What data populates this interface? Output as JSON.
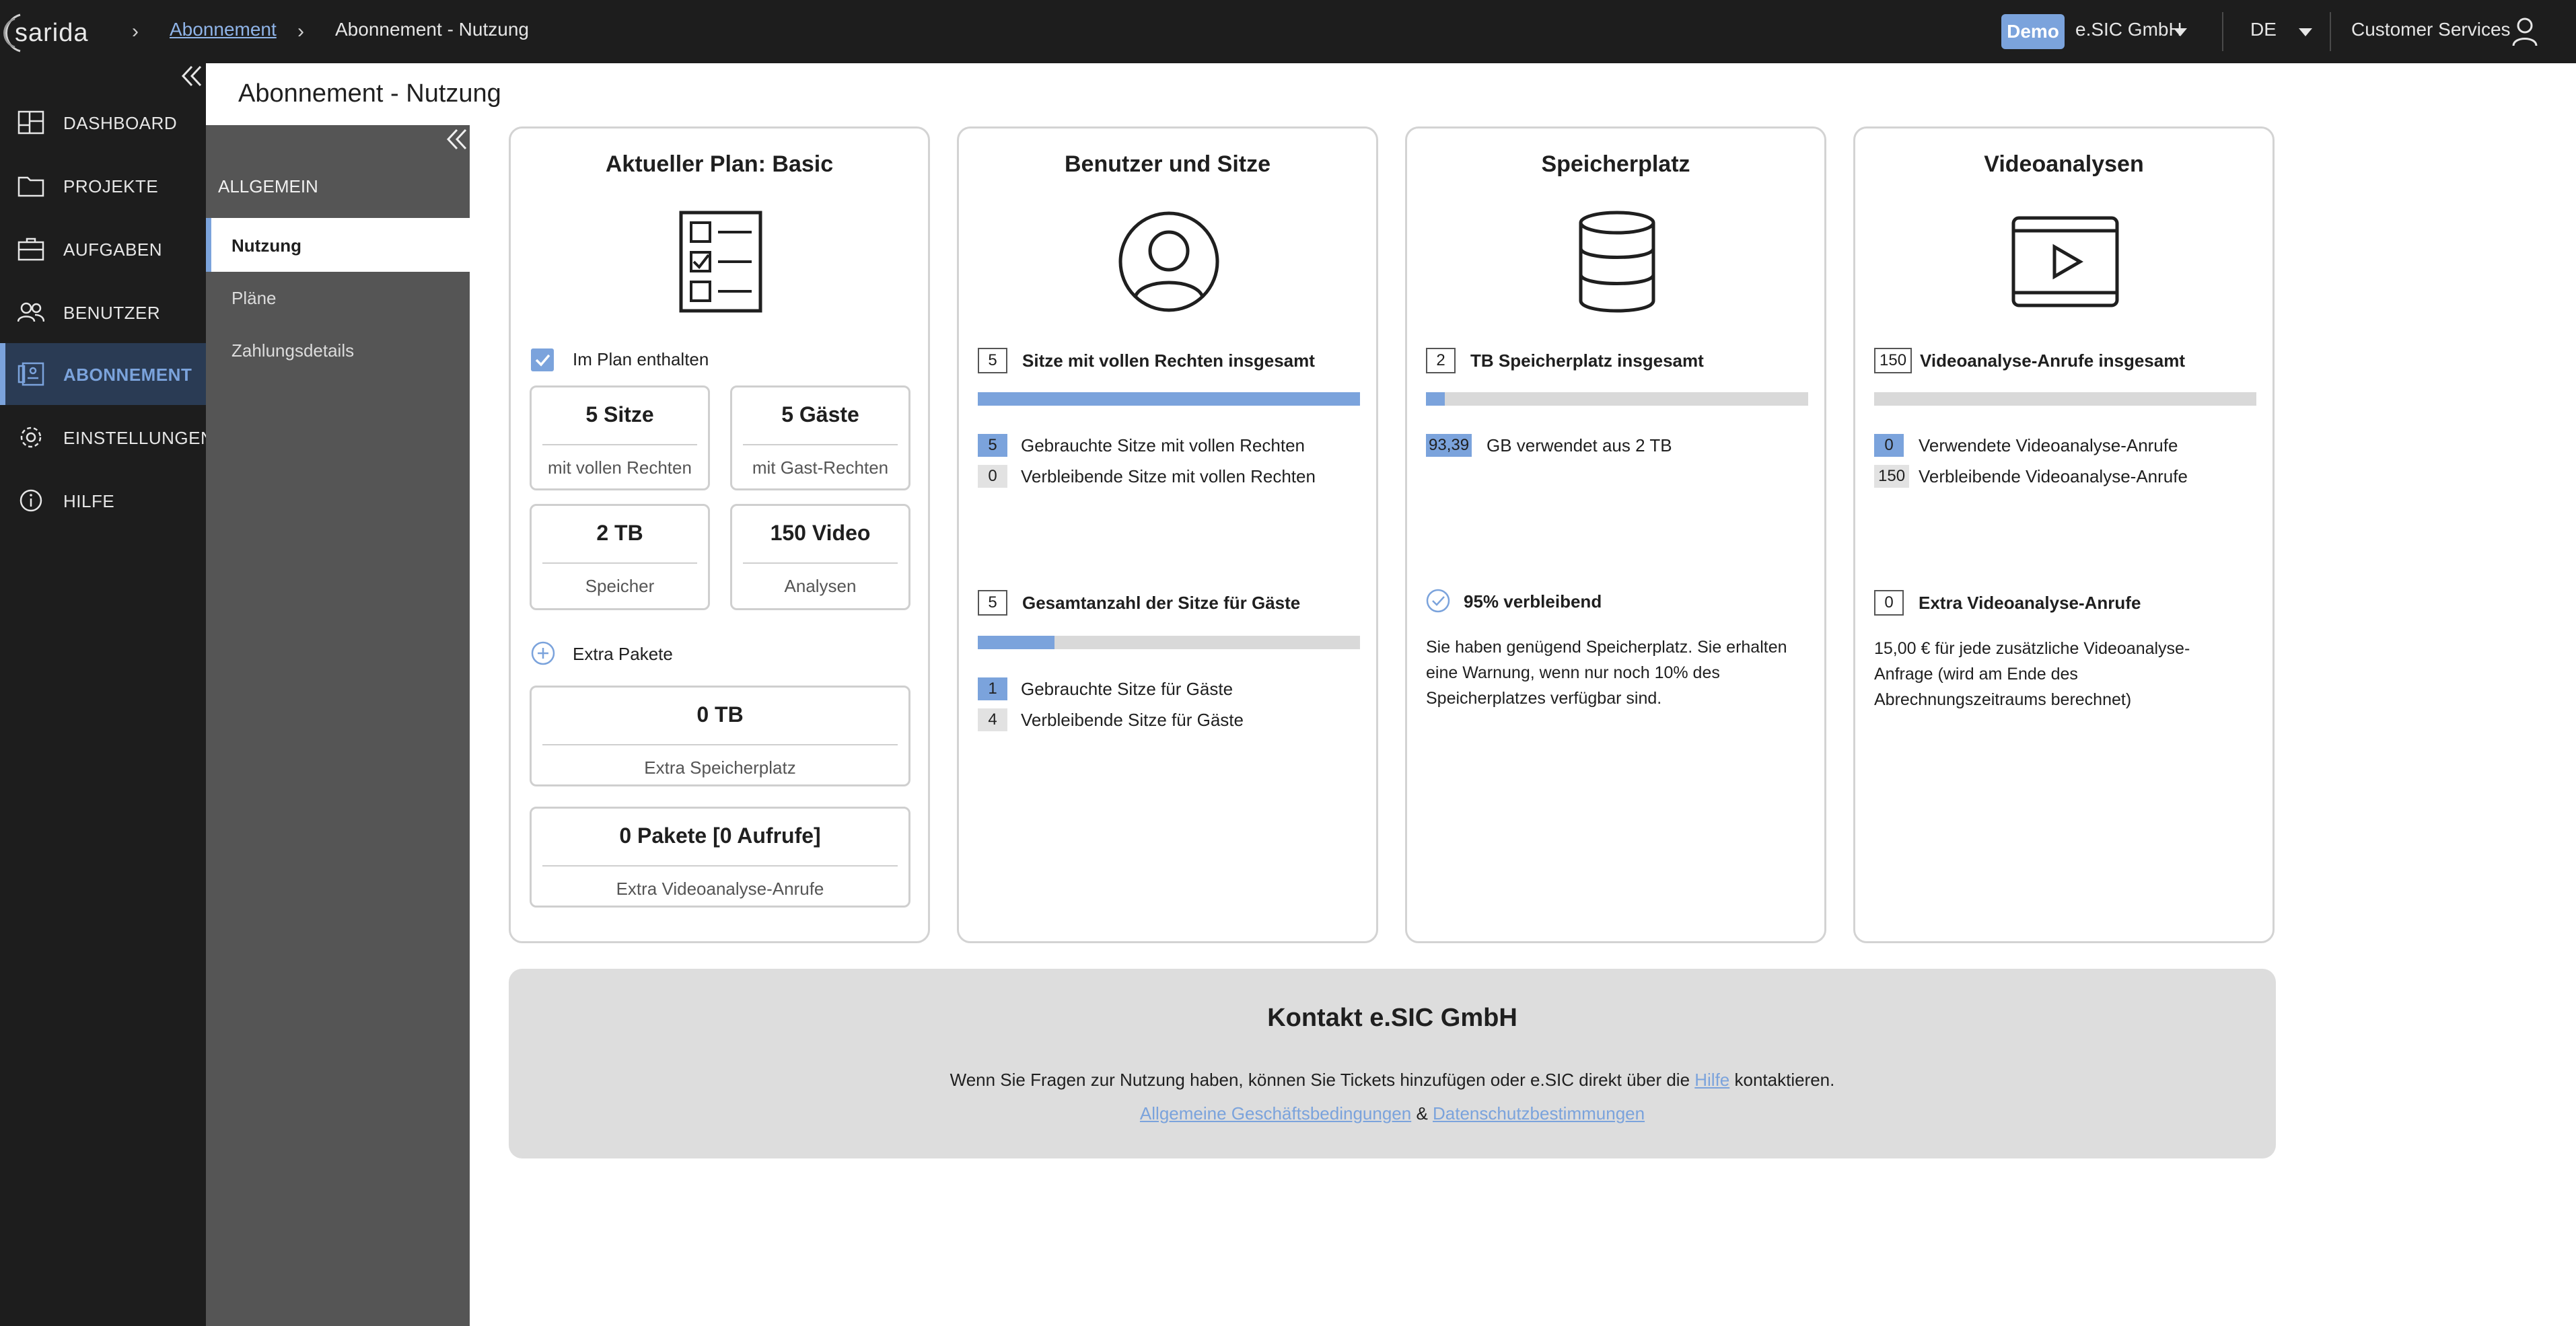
{
  "app": {
    "logo_text": "sarida"
  },
  "breadcrumb": {
    "items": [
      "Abonnement",
      "Abonnement - Nutzung"
    ]
  },
  "header": {
    "demo_badge": "Demo",
    "company": "e.SIC GmbH",
    "language": "DE",
    "user_label": "Customer Services"
  },
  "sidebar": {
    "items": [
      {
        "label": "DASHBOARD",
        "icon": "dashboard-icon"
      },
      {
        "label": "PROJEKTE",
        "icon": "folder-icon"
      },
      {
        "label": "AUFGABEN",
        "icon": "briefcase-icon"
      },
      {
        "label": "BENUTZER",
        "icon": "users-icon"
      },
      {
        "label": "ABONNEMENT",
        "icon": "subscription-icon",
        "active": true
      },
      {
        "label": "EINSTELLUNGEN",
        "icon": "gear-icon"
      },
      {
        "label": "HILFE",
        "icon": "info-icon"
      }
    ]
  },
  "subnav": {
    "heading": "ALLGEMEIN",
    "items": [
      {
        "label": "Nutzung",
        "active": true
      },
      {
        "label": "Pläne"
      },
      {
        "label": "Zahlungsdetails"
      }
    ]
  },
  "page": {
    "title": "Abonnement - Nutzung"
  },
  "plan": {
    "title": "Aktueller Plan: Basic",
    "included_label": "Im Plan enthalten",
    "tiles": [
      {
        "main": "5 Sitze",
        "sub": "mit vollen Rechten"
      },
      {
        "main": "5 Gäste",
        "sub": "mit Gast-Rechten"
      },
      {
        "main": "2 TB",
        "sub": "Speicher"
      },
      {
        "main": "150 Video",
        "sub": "Analysen"
      }
    ],
    "extra_label": "Extra Pakete",
    "extra_tiles": [
      {
        "main": "0 TB",
        "sub": "Extra Speicherplatz"
      },
      {
        "main": "0 Pakete [0 Aufrufe]",
        "sub": "Extra Videoanalyse-Anrufe"
      }
    ]
  },
  "users": {
    "title": "Benutzer und Sitze",
    "full": {
      "total": "5",
      "total_label": "Sitze mit vollen Rechten insgesamt",
      "used_fraction": 1.0,
      "used": "5",
      "used_label": "Gebrauchte Sitze mit vollen Rechten",
      "remaining": "0",
      "remaining_label": "Verbleibende Sitze mit vollen Rechten"
    },
    "guest": {
      "total": "5",
      "total_label": "Gesamtanzahl der Sitze für Gäste",
      "used_fraction": 0.2,
      "used": "1",
      "used_label": "Gebrauchte Sitze für Gäste",
      "remaining": "4",
      "remaining_label": "Verbleibende Sitze für Gäste"
    }
  },
  "storage": {
    "title": "Speicherplatz",
    "total": "2",
    "total_label": "TB Speicherplatz insgesamt",
    "used_fraction": 0.05,
    "used": "93,39",
    "used_label": "GB verwendet aus 2 TB",
    "remaining_label": "95% verbleibend",
    "note": "Sie haben genügend Speicherplatz. Sie erhalten eine Warnung, wenn nur noch 10% des Speicherplatzes verfügbar sind."
  },
  "video": {
    "title": "Videoanalysen",
    "total": "150",
    "total_label": "Videoanalyse-Anrufe insgesamt",
    "used_fraction": 0.0,
    "used": "0",
    "used_label": "Verwendete Videoanalyse-Anrufe",
    "remaining": "150",
    "remaining_label": "Verbleibende Videoanalyse-Anrufe",
    "extra": "0",
    "extra_label": "Extra Videoanalyse-Anrufe",
    "note": "15,00 € für jede zusätzliche Videoanalyse-Anfrage (wird am Ende des Abrechnungszeitraums berechnet)"
  },
  "contact": {
    "title": "Kontakt e.SIC GmbH",
    "text_before": "Wenn Sie Fragen zur Nutzung haben, können Sie Tickets hinzufügen oder e.SIC direkt über die ",
    "help_link": "Hilfe",
    "text_after": " kontaktieren.",
    "terms_link": "Allgemeine Geschäftsbedingungen",
    "amp": "&",
    "privacy_link": "Datenschutzbestimmungen"
  },
  "colors": {
    "accent": "#7ba3dc",
    "topbar": "#1d1d1d",
    "subnav": "#555555",
    "bar_bg": "#d9d9d9"
  }
}
